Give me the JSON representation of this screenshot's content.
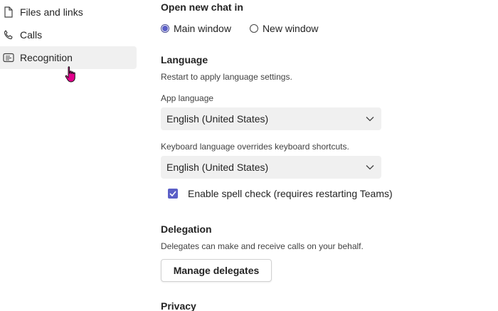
{
  "sidebar": {
    "items": [
      {
        "label": "Files and links",
        "icon": "file-icon",
        "active": false
      },
      {
        "label": "Calls",
        "icon": "phone-icon",
        "active": false
      },
      {
        "label": "Recognition",
        "icon": "recognition-icon",
        "active": true
      }
    ]
  },
  "chat": {
    "heading": "Open new chat in",
    "options": [
      {
        "label": "Main window",
        "selected": true
      },
      {
        "label": "New window",
        "selected": false
      }
    ]
  },
  "language": {
    "heading": "Language",
    "note": "Restart to apply language settings.",
    "app_language_label": "App language",
    "app_language_value": "English (United States)",
    "keyboard_label": "Keyboard language overrides keyboard shortcuts.",
    "keyboard_value": "English (United States)",
    "spellcheck_label": "Enable spell check (requires restarting Teams)",
    "spellcheck_checked": true
  },
  "delegation": {
    "heading": "Delegation",
    "description": "Delegates can make and receive calls on your behalf.",
    "button_label": "Manage delegates"
  },
  "next_section": {
    "heading": "Privacy"
  },
  "colors": {
    "accent": "#5b5fc7",
    "active_item_bg": "#f0f0f0",
    "field_bg": "#f0f0f0",
    "cursor": "#e3008c"
  }
}
